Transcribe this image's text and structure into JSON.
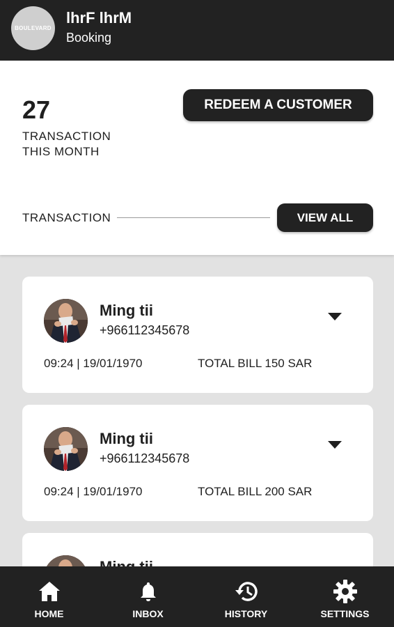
{
  "header": {
    "logo_text": "BOULEVARD",
    "title": "lhrF lhrM",
    "subtitle": "Booking"
  },
  "summary": {
    "count": "27",
    "count_label": "TRANSACTION\nTHIS MONTH",
    "redeem_label": "REDEEM A CUSTOMER",
    "section_label": "TRANSACTION",
    "view_all_label": "VIEW ALL"
  },
  "transactions": [
    {
      "name": "Ming tii",
      "phone": "+966112345678",
      "time": "09:24 | 19/01/1970",
      "bill": "TOTAL BILL 150 SAR"
    },
    {
      "name": "Ming tii",
      "phone": "+966112345678",
      "time": "09:24 | 19/01/1970",
      "bill": "TOTAL BILL 200 SAR"
    },
    {
      "name": "Ming tii",
      "phone": "",
      "time": "",
      "bill": ""
    }
  ],
  "nav": [
    {
      "label": "HOME",
      "icon": "home-icon"
    },
    {
      "label": "INBOX",
      "icon": "bell-icon"
    },
    {
      "label": "HISTORY",
      "icon": "history-icon"
    },
    {
      "label": "SETTINGS",
      "icon": "gear-icon"
    }
  ],
  "colors": {
    "bar": "#222222",
    "background": "#e2e2e2",
    "card": "#ffffff",
    "accent_mark": "#e64531"
  }
}
